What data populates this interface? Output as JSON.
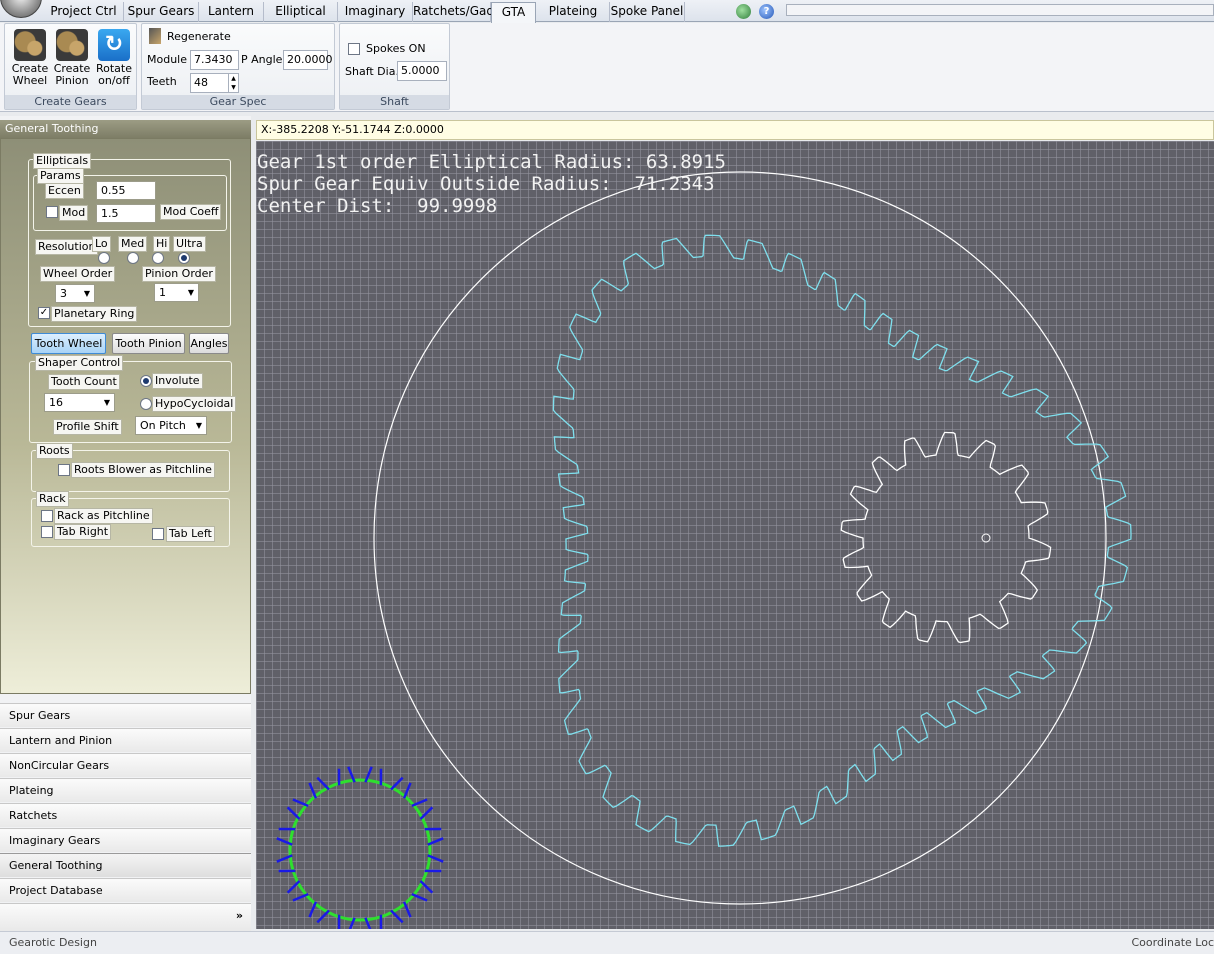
{
  "tabs": [
    "Project Ctrl",
    "Spur Gears",
    "Lantern",
    "Elliptical",
    "Imaginary",
    "Ratchets/Gad",
    "GTA",
    "Plateing",
    "Spoke Panel ,"
  ],
  "active_tab": "GTA",
  "ribbon": {
    "create_gears": {
      "caption": "Create Gears",
      "wheel_label": "Create Wheel",
      "pinion_label": "Create Pinion",
      "rotate_label": "Rotate on/off",
      "wheel_l1": "Create",
      "wheel_l2": "Wheel",
      "pinion_l1": "Create",
      "pinion_l2": "Pinion",
      "rotate_l1": "Rotate",
      "rotate_l2": "on/off"
    },
    "gear_spec": {
      "caption": "Gear Spec",
      "regenerate": "Regenerate",
      "module_label": "Module",
      "module_value": "7.3430",
      "pangle_label": "P Angle",
      "pangle_value": "20.0000",
      "teeth_label": "Teeth",
      "teeth_value": "48"
    },
    "shaft": {
      "caption": "Shaft",
      "spokes_label": "Spokes ON",
      "shaftdia_label": "Shaft Dia.",
      "shaftdia_value": "5.0000"
    }
  },
  "left_panel": {
    "header": "General Toothing",
    "ellipticals": {
      "caption": "Ellipticals",
      "params_caption": "Params",
      "eccen_label": "Eccen",
      "eccen_value": "0.55",
      "mod_label": "Mod",
      "mod_value": "1.5",
      "modcoeff_label": "Mod Coeff",
      "resolution_label": "Resolution",
      "res_lo": "Lo",
      "res_med": "Med",
      "res_hi": "Hi",
      "res_ultra": "Ultra",
      "wheel_order_label": "Wheel Order",
      "wheel_order_value": "3",
      "pinion_order_label": "Pinion Order",
      "pinion_order_value": "1",
      "planetary_label": "Planetary Ring",
      "planetary_checked": true
    },
    "buttons": {
      "tooth_wheel": "Tooth Wheel",
      "tooth_pinion": "Tooth Pinion",
      "angles": "Angles"
    },
    "shaper": {
      "caption": "Shaper Control",
      "tooth_count_label": "Tooth Count",
      "tooth_count_value": "16",
      "involute": "Involute",
      "hypocycloidal": "HypoCycloidal",
      "profile_shift_label": "Profile Shift",
      "profile_shift_value": "On Pitch"
    },
    "roots": {
      "caption": "Roots",
      "blower_label": "Roots Blower as Pitchline"
    },
    "rack": {
      "caption": "Rack",
      "pitchline_label": "Rack as Pitchline",
      "tab_right": "Tab Right",
      "tab_left": "Tab Left"
    },
    "nav": [
      "Spur Gears",
      "Lantern and Pinion",
      "NonCircular Gears",
      "Plateing",
      "Ratchets",
      "Imaginary Gears",
      "General Toothing",
      "Project Database"
    ],
    "nav_active": "General Toothing",
    "expand_glyph": "»"
  },
  "coords": "X:-385.2208 Y:-51.1744 Z:0.0000",
  "view_text": {
    "line1": "Gear 1st order Elliptical Radius: 63.8915",
    "line2": "Spur Gear Equiv Outside Radius:  71.2343",
    "line3": "Center Dist:  99.9998"
  },
  "view_colors": {
    "background": "#606068",
    "ring": "#7fe0ee",
    "pinion": "#ffffff",
    "circle": "#ffffff",
    "mini_circle": "#2ee02e",
    "mini_ticks": "#1a1ae6"
  },
  "status": {
    "left": "Gearotic Design",
    "right": "Coordinate Loc"
  }
}
